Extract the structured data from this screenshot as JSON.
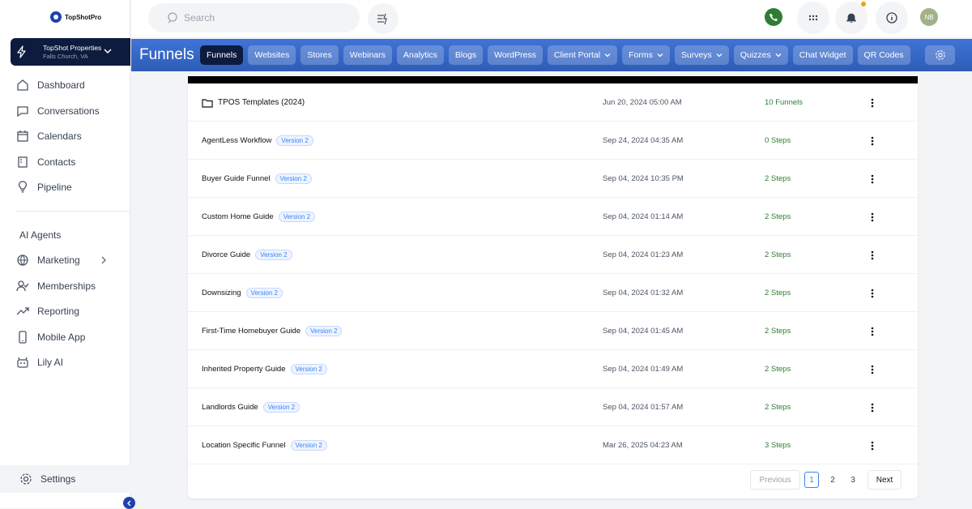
{
  "brand": {
    "name": "TopShotPro"
  },
  "account": {
    "name": "TopShot Properties",
    "location": "Falls Church, VA"
  },
  "sidebar": {
    "items": [
      {
        "label": "Dashboard"
      },
      {
        "label": "Conversations"
      },
      {
        "label": "Calendars"
      },
      {
        "label": "Contacts"
      },
      {
        "label": "Pipeline"
      }
    ],
    "section_label": "AI Agents",
    "items2": [
      {
        "label": "Marketing"
      },
      {
        "label": "Memberships"
      },
      {
        "label": "Reporting"
      },
      {
        "label": "Mobile App"
      },
      {
        "label": "Lily AI"
      }
    ],
    "settings_label": "Settings"
  },
  "topbar": {
    "search_placeholder": "Search",
    "avatar_initials": "NB",
    "phone_color": "#2e7d32",
    "notification_dot_color": "#f59e0b"
  },
  "header": {
    "title": "Funnels",
    "tabs": [
      {
        "label": "Funnels"
      },
      {
        "label": "Websites"
      },
      {
        "label": "Stores"
      },
      {
        "label": "Webinars"
      },
      {
        "label": "Analytics"
      },
      {
        "label": "Blogs"
      },
      {
        "label": "WordPress"
      },
      {
        "label": "Client Portal"
      },
      {
        "label": "Forms"
      },
      {
        "label": "Surveys"
      },
      {
        "label": "Quizzes"
      },
      {
        "label": "Chat Widget"
      },
      {
        "label": "QR Codes"
      }
    ]
  },
  "table": {
    "rows": [
      {
        "name": "TPOS Templates (2024)",
        "date": "Jun 20, 2024 05:00 AM",
        "steps": "10 Funnels"
      },
      {
        "name": "AgentLess Workflow",
        "badge": "Version 2",
        "date": "Sep 24, 2024 04:35 AM",
        "steps": "0 Steps"
      },
      {
        "name": "Buyer Guide Funnel",
        "badge": "Version 2",
        "date": "Sep 04, 2024 10:35 PM",
        "steps": "2 Steps"
      },
      {
        "name": "Custom Home Guide",
        "badge": "Version 2",
        "date": "Sep 04, 2024 01:14 AM",
        "steps": "2 Steps"
      },
      {
        "name": "Divorce Guide",
        "badge": "Version 2",
        "date": "Sep 04, 2024 01:23 AM",
        "steps": "2 Steps"
      },
      {
        "name": "Downsizing",
        "badge": "Version 2",
        "date": "Sep 04, 2024 01:32 AM",
        "steps": "2 Steps"
      },
      {
        "name": "First-Time Homebuyer Guide",
        "badge": "Version 2",
        "date": "Sep 04, 2024 01:45 AM",
        "steps": "2 Steps"
      },
      {
        "name": "Inherited Property Guide",
        "badge": "Version 2",
        "date": "Sep 04, 2024 01:49 AM",
        "steps": "2 Steps"
      },
      {
        "name": "Landlords Guide",
        "badge": "Version 2",
        "date": "Sep 04, 2024 01:57 AM",
        "steps": "2 Steps"
      },
      {
        "name": "Location Specific Funnel",
        "badge": "Version 2",
        "date": "Mar 26, 2025 04:23 AM",
        "steps": "3 Steps"
      }
    ]
  },
  "pagination": {
    "previous": "Previous",
    "pages": [
      "1",
      "2",
      "3"
    ],
    "current": "1",
    "next": "Next"
  }
}
